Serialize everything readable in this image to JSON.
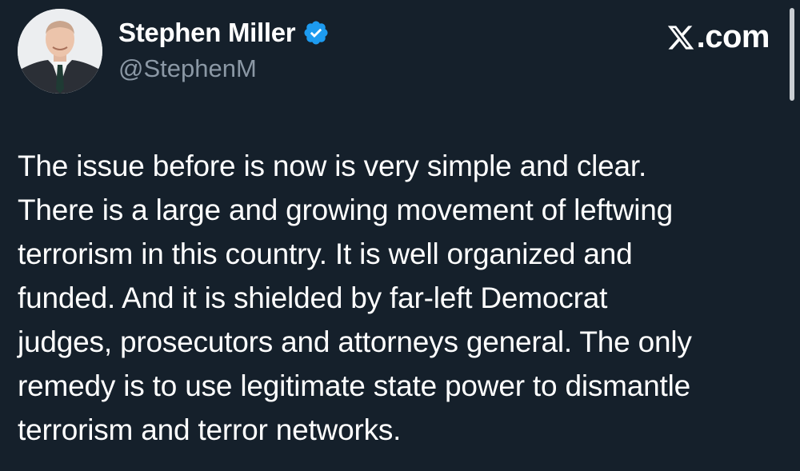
{
  "author": {
    "display_name": "Stephen Miller",
    "handle": "@StephenM",
    "verified": true
  },
  "source": {
    "logo_icon": "x-logo-icon",
    "label": ".com"
  },
  "tweet": {
    "text": "The issue before is now is very simple and clear.\nThere is a large and growing movement of leftwing\nterrorism in this country. It is well organized and\nfunded. And it is shielded by far-left Democrat\njudges, prosecutors and attorneys general. The only\nremedy is to use legitimate state power to dismantle\nterrorism and terror networks."
  },
  "colors": {
    "background": "#15202b",
    "text_primary": "#ffffff",
    "text_secondary": "#8b98a5",
    "verified_badge": "#1d9bf0"
  }
}
